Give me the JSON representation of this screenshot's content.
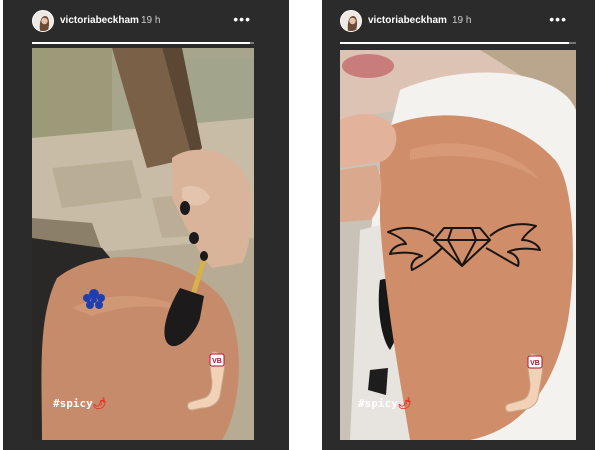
{
  "stories": [
    {
      "username": "victoriabeckham",
      "time": "19 h",
      "more_icon": "more-dots-icon",
      "progress": 0.98,
      "hashtag": "#spicy",
      "sticker_label": "VB"
    },
    {
      "username": "victoriabeckham",
      "time": "19 h",
      "more_icon": "more-dots-icon",
      "progress": 0.97,
      "hashtag": "#spicy",
      "sticker_label": "VB"
    }
  ],
  "colors": {
    "panel": "#2b2b2b",
    "skin": "#c98c6b",
    "tattoo_blue": "#1f3fae",
    "chili": "#e2342a"
  }
}
